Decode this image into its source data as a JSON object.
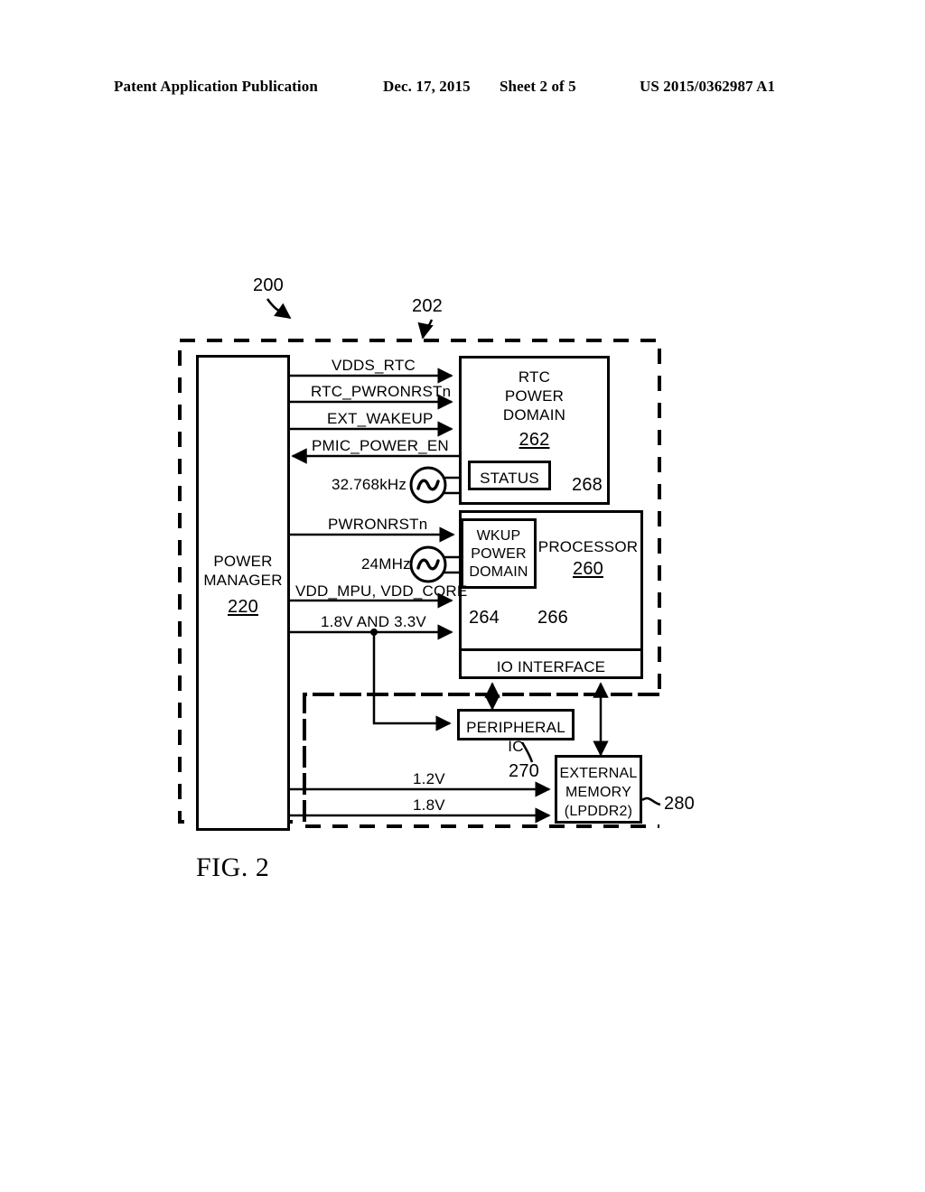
{
  "header": {
    "publication": "Patent Application Publication",
    "date": "Dec. 17, 2015",
    "sheet": "Sheet 2 of 5",
    "number": "US 2015/0362987 A1"
  },
  "figure": {
    "caption": "FIG. 2",
    "system_ref": "200",
    "soc_ref": "202"
  },
  "blocks": {
    "power_manager": {
      "label": "POWER\nMANAGER",
      "ref": "220"
    },
    "rtc_power_domain": {
      "label": "RTC\nPOWER\nDOMAIN",
      "ref": "262"
    },
    "status": {
      "label": "STATUS",
      "ref": "268"
    },
    "processor": {
      "label": "PROCESSOR",
      "ref": "260"
    },
    "wkup_power_domain": {
      "label": "WKUP\nPOWER\nDOMAIN",
      "ref": "264"
    },
    "io_interface": {
      "label": "IO INTERFACE",
      "ref": "266"
    },
    "peripheral_ic": {
      "label": "PERIPHERAL IC",
      "ref": "270"
    },
    "external_memory": {
      "label": "EXTERNAL\nMEMORY\n(LPDDR2)",
      "ref": "280"
    }
  },
  "signals": {
    "vdds_rtc": "VDDS_RTC",
    "rtc_pwronrstn": "RTC_PWRONRSTn",
    "ext_wakeup": "EXT_WAKEUP",
    "pmic_power_en": "PMIC_POWER_EN",
    "osc_rtc": "32.768kHz",
    "pwronrstn": "PWRONRSTn",
    "osc_main": "24MHz",
    "vdd_rails": "VDD_MPU, VDD_CORE",
    "io_rails": "1.8V AND 3.3V",
    "mem_rail_1": "1.2V",
    "mem_rail_2": "1.8V"
  },
  "colors": {
    "ink": "#000000",
    "paper": "#ffffff"
  }
}
